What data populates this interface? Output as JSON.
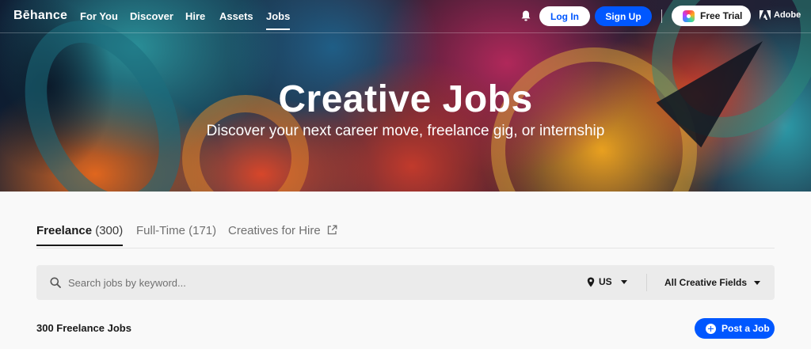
{
  "brand": {
    "logo_text": "Bēhance"
  },
  "nav": {
    "items": [
      {
        "label": "For You"
      },
      {
        "label": "Discover"
      },
      {
        "label": "Hire"
      },
      {
        "label": "Assets"
      },
      {
        "label": "Jobs",
        "active": true
      }
    ],
    "login_label": "Log In",
    "signup_label": "Sign Up",
    "trial_label": "Free Trial",
    "adobe_label": "Adobe"
  },
  "hero": {
    "title": "Creative Jobs",
    "subtitle": "Discover your next career move, freelance gig, or internship"
  },
  "tabs": [
    {
      "label": "Freelance",
      "count": "(300)",
      "active": true
    },
    {
      "label": "Full-Time",
      "count": "(171)"
    },
    {
      "label": "Creatives for Hire",
      "icon": "external-link-icon"
    }
  ],
  "search": {
    "placeholder": "Search jobs by keyword...",
    "location": "US",
    "fields": "All Creative Fields"
  },
  "results": {
    "count_text": "300 Freelance Jobs",
    "post_label": "Post a Job"
  },
  "colors": {
    "accent_blue": "#0057ff",
    "page_bg": "#f9f9f9",
    "search_bg": "#ebebeb"
  }
}
